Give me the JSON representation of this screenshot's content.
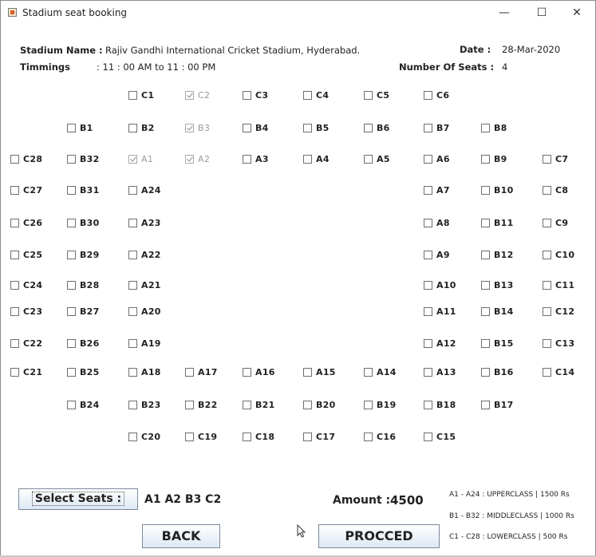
{
  "window": {
    "title": "Stadium seat booking",
    "minimize": "—",
    "maximize": "☐",
    "close": "✕"
  },
  "info": {
    "stadium_label": "Stadium Name :",
    "stadium_value": "Rajiv Gandhi International Cricket Stadium, Hyderabad.",
    "date_label": "Date :",
    "date_value": "28-Mar-2020",
    "timings_label": "Timmings",
    "timings_value": ": 11 : 00 AM to 11 : 00 PM",
    "seats_label": "Number Of Seats :",
    "seats_value": "4"
  },
  "seats": [
    {
      "label": "C1",
      "checked": false
    },
    {
      "label": "C2",
      "checked": true
    },
    {
      "label": "C3",
      "checked": false
    },
    {
      "label": "C4",
      "checked": false
    },
    {
      "label": "C5",
      "checked": false
    },
    {
      "label": "C6",
      "checked": false
    },
    {
      "label": "B1",
      "checked": false
    },
    {
      "label": "B2",
      "checked": false
    },
    {
      "label": "B3",
      "checked": true
    },
    {
      "label": "B4",
      "checked": false
    },
    {
      "label": "B5",
      "checked": false
    },
    {
      "label": "B6",
      "checked": false
    },
    {
      "label": "B7",
      "checked": false
    },
    {
      "label": "B8",
      "checked": false
    },
    {
      "label": "C28",
      "checked": false
    },
    {
      "label": "B32",
      "checked": false
    },
    {
      "label": "A1",
      "checked": true
    },
    {
      "label": "A2",
      "checked": true
    },
    {
      "label": "A3",
      "checked": false
    },
    {
      "label": "A4",
      "checked": false
    },
    {
      "label": "A5",
      "checked": false
    },
    {
      "label": "A6",
      "checked": false
    },
    {
      "label": "B9",
      "checked": false
    },
    {
      "label": "C7",
      "checked": false
    },
    {
      "label": "C27",
      "checked": false
    },
    {
      "label": "B31",
      "checked": false
    },
    {
      "label": "A24",
      "checked": false
    },
    {
      "label": "A7",
      "checked": false
    },
    {
      "label": "B10",
      "checked": false
    },
    {
      "label": "C8",
      "checked": false
    },
    {
      "label": "C26",
      "checked": false
    },
    {
      "label": "B30",
      "checked": false
    },
    {
      "label": "A23",
      "checked": false
    },
    {
      "label": "A8",
      "checked": false
    },
    {
      "label": "B11",
      "checked": false
    },
    {
      "label": "C9",
      "checked": false
    },
    {
      "label": "C25",
      "checked": false
    },
    {
      "label": "B29",
      "checked": false
    },
    {
      "label": "A22",
      "checked": false
    },
    {
      "label": "A9",
      "checked": false
    },
    {
      "label": "B12",
      "checked": false
    },
    {
      "label": "C10",
      "checked": false
    },
    {
      "label": "C24",
      "checked": false
    },
    {
      "label": "B28",
      "checked": false
    },
    {
      "label": "A21",
      "checked": false
    },
    {
      "label": "A10",
      "checked": false
    },
    {
      "label": "B13",
      "checked": false
    },
    {
      "label": "C11",
      "checked": false
    },
    {
      "label": "C23",
      "checked": false
    },
    {
      "label": "B27",
      "checked": false
    },
    {
      "label": "A20",
      "checked": false
    },
    {
      "label": "A11",
      "checked": false
    },
    {
      "label": "B14",
      "checked": false
    },
    {
      "label": "C12",
      "checked": false
    },
    {
      "label": "C22",
      "checked": false
    },
    {
      "label": "B26",
      "checked": false
    },
    {
      "label": "A19",
      "checked": false
    },
    {
      "label": "A12",
      "checked": false
    },
    {
      "label": "B15",
      "checked": false
    },
    {
      "label": "C13",
      "checked": false
    },
    {
      "label": "C21",
      "checked": false
    },
    {
      "label": "B25",
      "checked": false
    },
    {
      "label": "A18",
      "checked": false
    },
    {
      "label": "A17",
      "checked": false
    },
    {
      "label": "A16",
      "checked": false
    },
    {
      "label": "A15",
      "checked": false
    },
    {
      "label": "A14",
      "checked": false
    },
    {
      "label": "A13",
      "checked": false
    },
    {
      "label": "B16",
      "checked": false
    },
    {
      "label": "C14",
      "checked": false
    },
    {
      "label": "B24",
      "checked": false
    },
    {
      "label": "B23",
      "checked": false
    },
    {
      "label": "B22",
      "checked": false
    },
    {
      "label": "B21",
      "checked": false
    },
    {
      "label": "B20",
      "checked": false
    },
    {
      "label": "B19",
      "checked": false
    },
    {
      "label": "B18",
      "checked": false
    },
    {
      "label": "B17",
      "checked": false
    },
    {
      "label": "C20",
      "checked": false
    },
    {
      "label": "C19",
      "checked": false
    },
    {
      "label": "C18",
      "checked": false
    },
    {
      "label": "C17",
      "checked": false
    },
    {
      "label": "C16",
      "checked": false
    },
    {
      "label": "C15",
      "checked": false
    }
  ],
  "footer": {
    "select_button": "Select Seats  :",
    "selected_seats": "A1 A2 B3 C2",
    "amount_label": "Amount :",
    "amount_value": "4500",
    "back_button": "BACK",
    "proceed_button": "PROCCED",
    "legend": [
      "A1 - A24 : UPPERCLASS | 1500 Rs",
      "B1 - B32  : MIDDLECLASS | 1000 Rs",
      "C1 - C28 : LOWERCLASS | 500 Rs"
    ]
  }
}
